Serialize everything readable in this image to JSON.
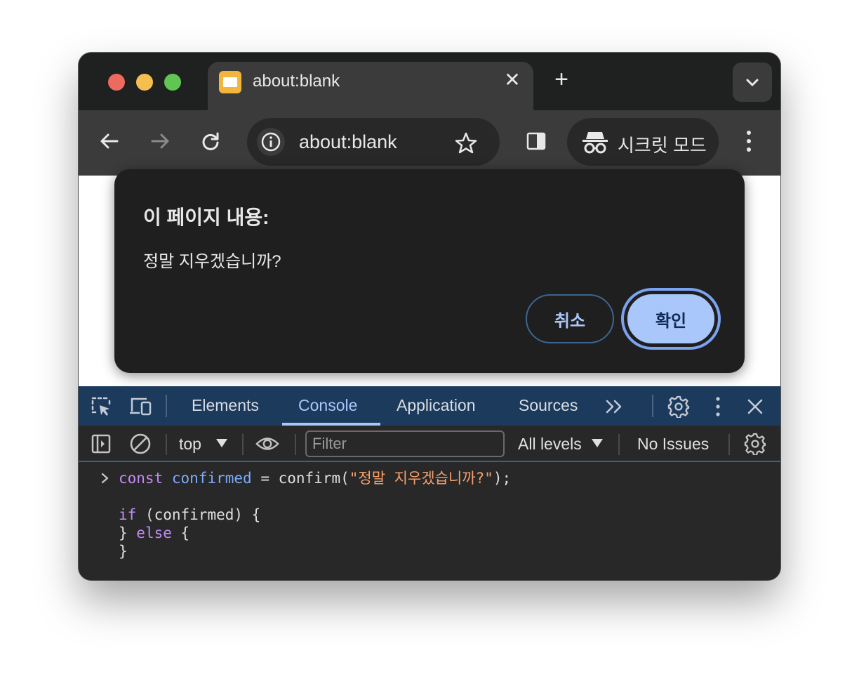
{
  "browser": {
    "tab": {
      "title": "about:blank",
      "close_glyph": "✕"
    },
    "new_tab_glyph": "+",
    "omnibox": {
      "url": "about:blank"
    },
    "incognito": {
      "label": "시크릿 모드"
    }
  },
  "dialog": {
    "title": "이 페이지 내용:",
    "message": "정말 지우겠습니까?",
    "cancel_label": "취소",
    "ok_label": "확인"
  },
  "devtools": {
    "tabs": [
      "Elements",
      "Console",
      "Application",
      "Sources"
    ],
    "active_tab": "Console",
    "filterbar": {
      "context": "top",
      "filter_placeholder": "Filter",
      "levels": "All levels",
      "issues": "No Issues"
    },
    "console": {
      "line1": {
        "kw": "const",
        "var": "confirmed",
        "op": " = confirm(",
        "str": "\"정말 지우겠습니까?\"",
        "end": ");"
      },
      "line2": {
        "kw": "if",
        "rest": " (confirmed) {"
      },
      "line3": {
        "open": "} ",
        "kw": "else",
        "rest": " {"
      },
      "line4": {
        "text": "}"
      }
    }
  },
  "colors": {
    "accent": "#a9c7fa",
    "devtools_tabbar": "#1b3a5c",
    "keyword": "#c58af9",
    "variable": "#7cacf8",
    "string": "#f7a06b"
  },
  "icons": [
    "back-arrow-icon",
    "forward-arrow-icon",
    "reload-icon",
    "info-icon",
    "star-icon",
    "side-panel-icon",
    "incognito-icon",
    "more-vertical-icon",
    "chevron-down-icon",
    "inspect-element-icon",
    "device-toggle-icon",
    "more-tabs-icon",
    "gear-icon",
    "close-icon",
    "sidebar-toggle-icon",
    "clear-console-icon",
    "eye-icon"
  ]
}
